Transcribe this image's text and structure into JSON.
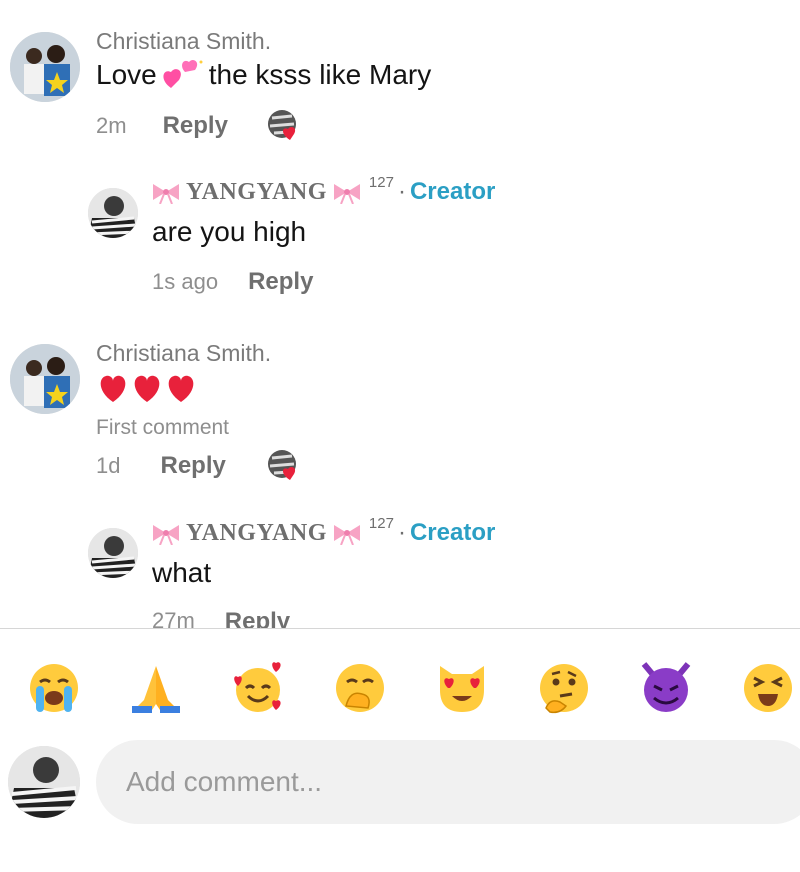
{
  "comments": [
    {
      "author": "Christiana Smith.",
      "text_before": "Love",
      "text_emoji": "sparkling-hearts",
      "text_after": "the ksss like Mary",
      "time": "2m",
      "reply_label": "Reply",
      "reply": {
        "handle": "YANGYANG",
        "count": "127",
        "sep": "·",
        "badge": "Creator",
        "text": "are you high",
        "time": "1s ago",
        "reply_label": "Reply"
      }
    },
    {
      "author": "Christiana Smith.",
      "text_emoji": "three-red-hearts",
      "note": "First comment",
      "time": "1d",
      "reply_label": "Reply",
      "reply": {
        "handle": "YANGYANG",
        "count": "127",
        "sep": "·",
        "badge": "Creator",
        "text": "what",
        "time": "27m",
        "reply_label": "Reply"
      }
    }
  ],
  "quick_emojis": [
    "crying",
    "folded-hands",
    "smiling-with-hearts",
    "hand-over-mouth",
    "heart-eyes-cat",
    "thinking",
    "smiling-devil",
    "tired"
  ],
  "composer": {
    "placeholder": "Add comment..."
  },
  "colors": {
    "creator": "#2b9fc4",
    "heart": "#e8213b",
    "bow": "#f7a3c4"
  }
}
